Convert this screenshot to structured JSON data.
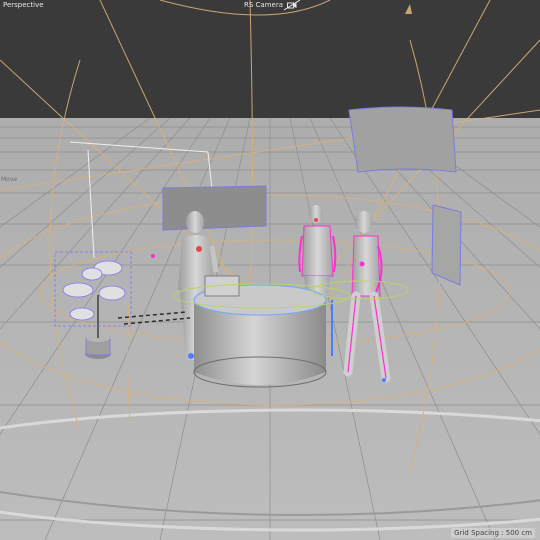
{
  "viewport": {
    "view_name": "Perspective",
    "camera_name": "RS Camera",
    "side_label": "Move",
    "grid_info": "Grid Spacing : 500 cm",
    "camera_icon": "camera-icon"
  },
  "colors": {
    "sky": "#3a3a3a",
    "floor": "#b7b7b7",
    "grid_line": "#8f8f8f",
    "camera_guides": "#d7b27a",
    "selection_blue": "#7b74ff",
    "selection_magenta": "#ff2fd0",
    "spline_green": "#b6d46b",
    "geometry": "#c8c8c8"
  }
}
